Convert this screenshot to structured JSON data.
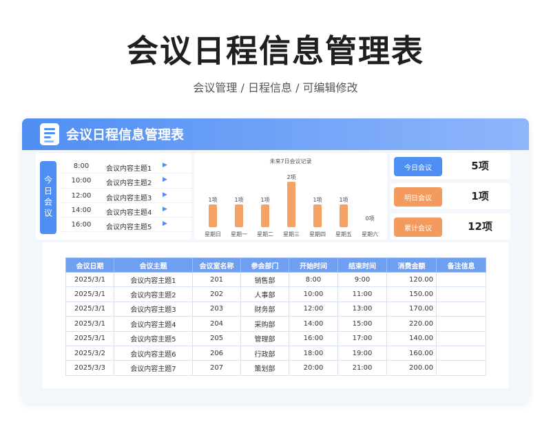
{
  "page": {
    "title": "会议日程信息管理表",
    "subtitle": "会议管理 / 日程信息 /  可编辑修改"
  },
  "card": {
    "title": "会议日程信息管理表"
  },
  "today": {
    "label": "今日会议",
    "items": [
      {
        "time": "8:00",
        "subject": "会议内容主题1"
      },
      {
        "time": "10:00",
        "subject": "会议内容主题2"
      },
      {
        "time": "12:00",
        "subject": "会议内容主题3"
      },
      {
        "time": "14:00",
        "subject": "会议内容主题4"
      },
      {
        "time": "16:00",
        "subject": "会议内容主题5"
      }
    ]
  },
  "chart_data": {
    "type": "bar",
    "title": "未来7日会议记录",
    "categories": [
      "星期日",
      "星期一",
      "星期二",
      "星期三",
      "星期四",
      "星期五",
      "星期六"
    ],
    "values": [
      1,
      1,
      1,
      2,
      1,
      1,
      0
    ],
    "labels": [
      "1项",
      "1项",
      "1项",
      "2项",
      "1项",
      "1项",
      "0项"
    ],
    "ylim": [
      0,
      2
    ],
    "color": "#f5a266"
  },
  "stats": [
    {
      "label": "今日会议",
      "value": "5项",
      "color": "#4f8ef2"
    },
    {
      "label": "明日会议",
      "value": "1项",
      "color": "#f39a5e"
    },
    {
      "label": "累计会议",
      "value": "12项",
      "color": "#f39a5e"
    }
  ],
  "table": {
    "headers": [
      "会议日期",
      "会议主题",
      "会议室名称",
      "参会部门",
      "开始时间",
      "结束时间",
      "消费金额",
      "备注信息"
    ],
    "rows": [
      [
        "2025/3/1",
        "会议内容主题1",
        "201",
        "销售部",
        "8:00",
        "9:00",
        "120.00",
        ""
      ],
      [
        "2025/3/1",
        "会议内容主题2",
        "202",
        "人事部",
        "10:00",
        "11:00",
        "150.00",
        ""
      ],
      [
        "2025/3/1",
        "会议内容主题3",
        "203",
        "财务部",
        "12:00",
        "13:00",
        "170.00",
        ""
      ],
      [
        "2025/3/1",
        "会议内容主题4",
        "204",
        "采购部",
        "14:00",
        "15:00",
        "220.00",
        ""
      ],
      [
        "2025/3/1",
        "会议内容主题5",
        "205",
        "管理部",
        "16:00",
        "17:00",
        "140.00",
        ""
      ],
      [
        "2025/3/2",
        "会议内容主题6",
        "206",
        "行政部",
        "18:00",
        "19:00",
        "160.00",
        ""
      ],
      [
        "2025/3/3",
        "会议内容主题7",
        "207",
        "策划部",
        "20:00",
        "21:00",
        "200.00",
        ""
      ]
    ]
  }
}
